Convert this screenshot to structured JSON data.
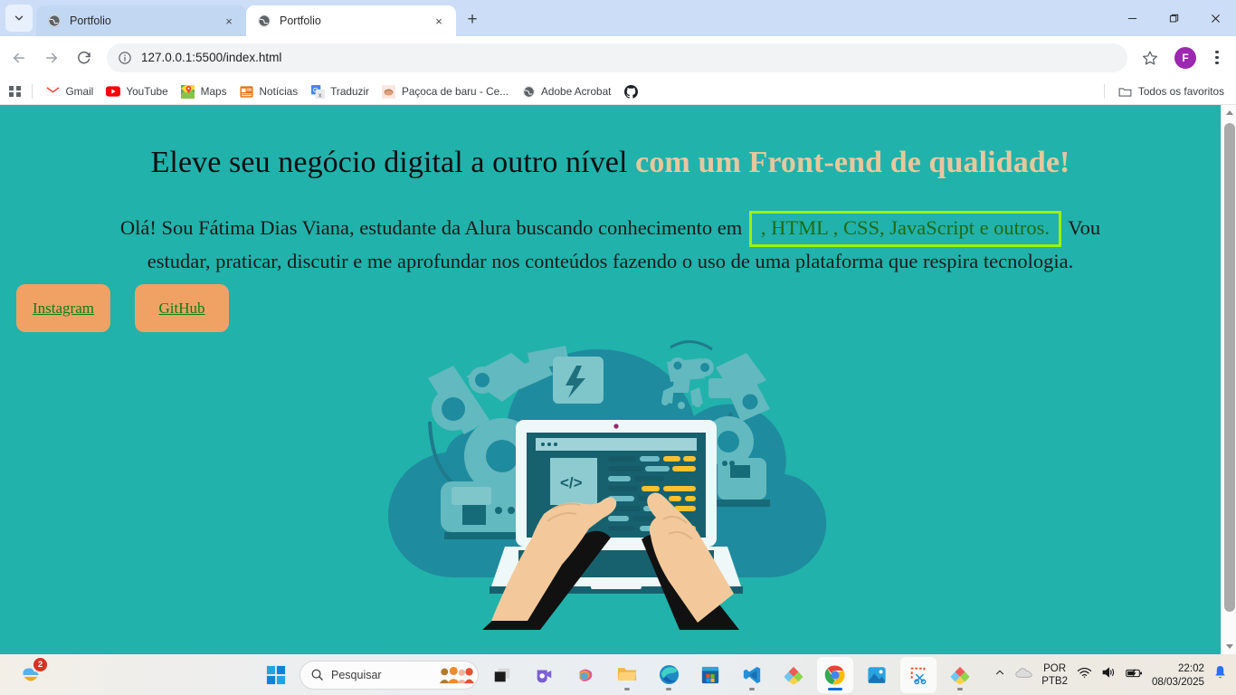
{
  "browser": {
    "tabs": [
      {
        "title": "Portfolio",
        "active": false
      },
      {
        "title": "Portfolio",
        "active": true
      }
    ],
    "new_tab_label": "+",
    "tab_close_label": "×",
    "address": "127.0.0.1:5500/index.html",
    "avatar_initial": "F",
    "window_controls": {
      "minimize": "minimize",
      "maximize": "maximize",
      "close": "close"
    },
    "bookmarks": [
      {
        "label": "Gmail",
        "icon": "gmail-icon"
      },
      {
        "label": "YouTube",
        "icon": "youtube-icon"
      },
      {
        "label": "Maps",
        "icon": "maps-icon"
      },
      {
        "label": "Notícias",
        "icon": "news-icon"
      },
      {
        "label": "Traduzir",
        "icon": "translate-icon"
      },
      {
        "label": "Paçoca de baru - Ce...",
        "icon": "generic-site-icon"
      },
      {
        "label": "Adobe Acrobat",
        "icon": "acrobat-icon"
      },
      {
        "label": "",
        "icon": "github-icon"
      }
    ],
    "bookmarks_overflow": "Todos os favoritos"
  },
  "page": {
    "headline_plain": "Eleve seu negócio digital a outro nível ",
    "headline_accent": "com um Front-end de qualidade!",
    "intro_before": "Olá! Sou Fátima Dias Viana, estudante da Alura buscando conhecimento em ",
    "intro_highlight": ", HTML , CSS, JavaScript e outros.",
    "intro_after": " Vou estudar, praticar, discutir e me aprofundar nos conteúdos fazendo o uso de uma plataforma que respira tecnologia.",
    "buttons": [
      {
        "label": "Instagram"
      },
      {
        "label": "GitHub"
      }
    ],
    "illustration_alt": "hands-typing-on-laptop-with-robot-arms-illustration",
    "colors": {
      "background": "#21b2ab",
      "cloud": "#1f8b9e",
      "headline_accent": "#e8c79d",
      "highlight_border": "#9bf20a",
      "highlight_text": "#1f6b13",
      "button_background": "#f0a265",
      "button_text": "#137a16"
    }
  },
  "taskbar": {
    "search_placeholder": "Pesquisar",
    "weather_badge": "2",
    "language": {
      "line1": "POR",
      "line2": "PTB2"
    },
    "clock": {
      "time": "22:02",
      "date": "08/03/2025"
    },
    "apps": [
      {
        "name": "taskview-icon",
        "running": false
      },
      {
        "name": "teams-icon",
        "running": false
      },
      {
        "name": "copilot-icon",
        "running": false
      },
      {
        "name": "file-explorer-icon",
        "running": true
      },
      {
        "name": "edge-icon",
        "running": true
      },
      {
        "name": "microsoft-store-icon",
        "running": false
      },
      {
        "name": "vscode-icon",
        "running": true
      },
      {
        "name": "office-icon",
        "running": false
      },
      {
        "name": "chrome-icon",
        "running": true
      },
      {
        "name": "photos-icon",
        "running": false
      },
      {
        "name": "snipping-tool-icon",
        "running": false
      },
      {
        "name": "office-2-icon",
        "running": true
      }
    ]
  }
}
